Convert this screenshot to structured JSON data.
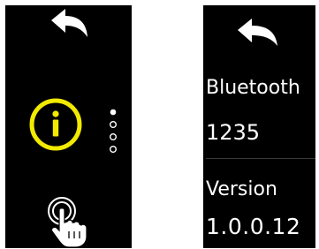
{
  "colors": {
    "screen_background": "#000000",
    "page_background": "#ffffff",
    "accent_yellow": "#f2ea00",
    "icon_white": "#ffffff"
  },
  "left_screen": {
    "back_icon": "back-arrow-icon",
    "main_icon": "info-icon",
    "bottom_icon": "touch-tap-icon",
    "page_indicator": {
      "total_pages": 4,
      "active_index": 0
    }
  },
  "right_screen": {
    "back_icon": "back-arrow-icon",
    "bluetooth_label": "Bluetooth",
    "bluetooth_value": "1235",
    "version_label": "Version",
    "version_value": "1.0.0.12"
  }
}
